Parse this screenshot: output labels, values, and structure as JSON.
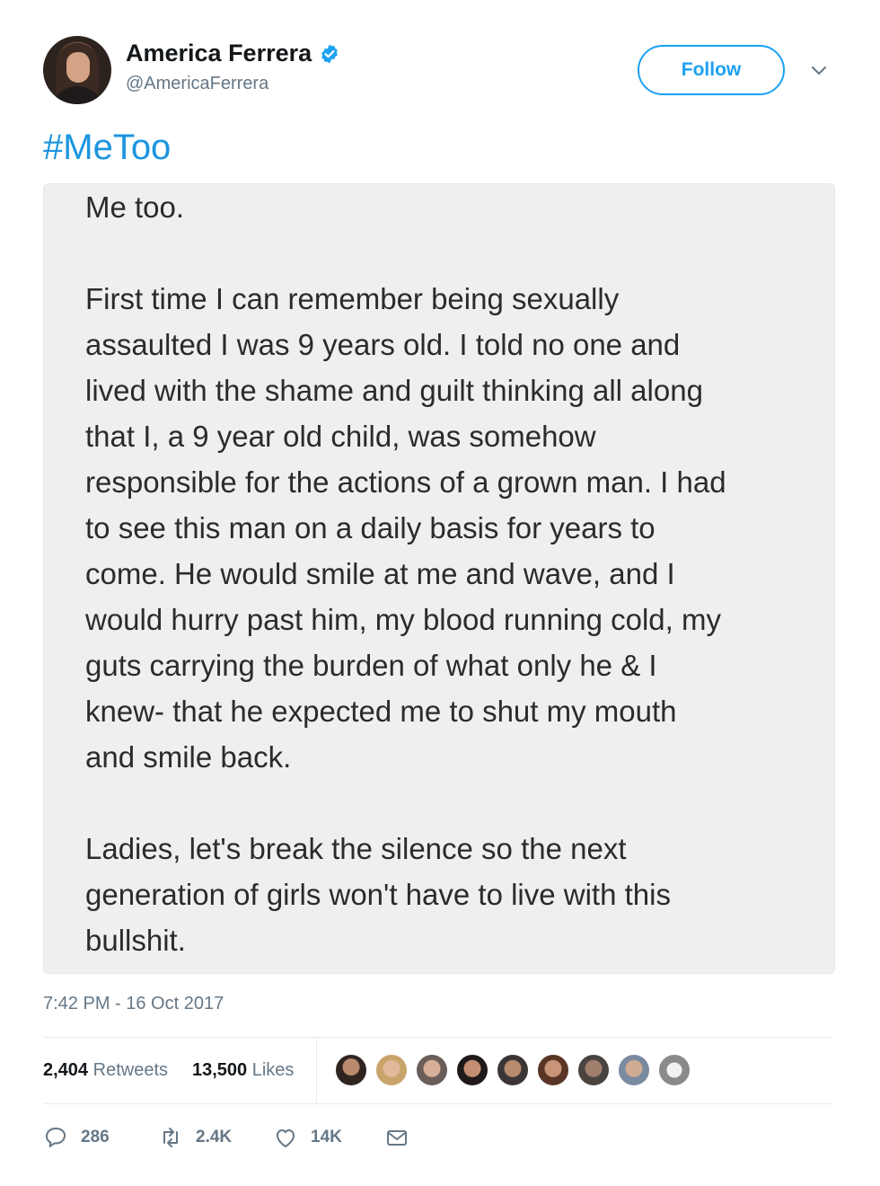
{
  "author": {
    "display_name": "America Ferrera",
    "handle": "@AmericaFerrera",
    "verified": true
  },
  "follow_label": "Follow",
  "hashtag": "#MeToo",
  "media_text": {
    "line1": "Me too.",
    "para2": [
      "First time I can remember being sexually",
      "assaulted I was 9 years old. I told no one and",
      "lived with the shame and guilt thinking all along",
      "that I, a 9 year old child, was somehow",
      "responsible for the actions of a grown man. I had",
      "to see this man on a daily basis for years to",
      "come. He would smile at me and wave, and I",
      "would hurry past him, my blood running cold, my",
      "guts carrying the burden of what only he & I",
      "knew- that he expected me to shut my mouth",
      "and smile back."
    ],
    "para3": [
      "Ladies, let's break the silence so the next",
      "generation of girls won't have to live with this",
      "bullshit."
    ]
  },
  "timestamp": "7:42 PM - 16 Oct 2017",
  "stats": {
    "retweets_count": "2,404",
    "retweets_label": "Retweets",
    "likes_count": "13,500",
    "likes_label": "Likes"
  },
  "actions": {
    "replies": "286",
    "retweets": "2.4K",
    "likes": "14K"
  },
  "colors": {
    "accent": "#1da1f2",
    "hashtag": "#1b95e0",
    "muted": "#657786"
  }
}
